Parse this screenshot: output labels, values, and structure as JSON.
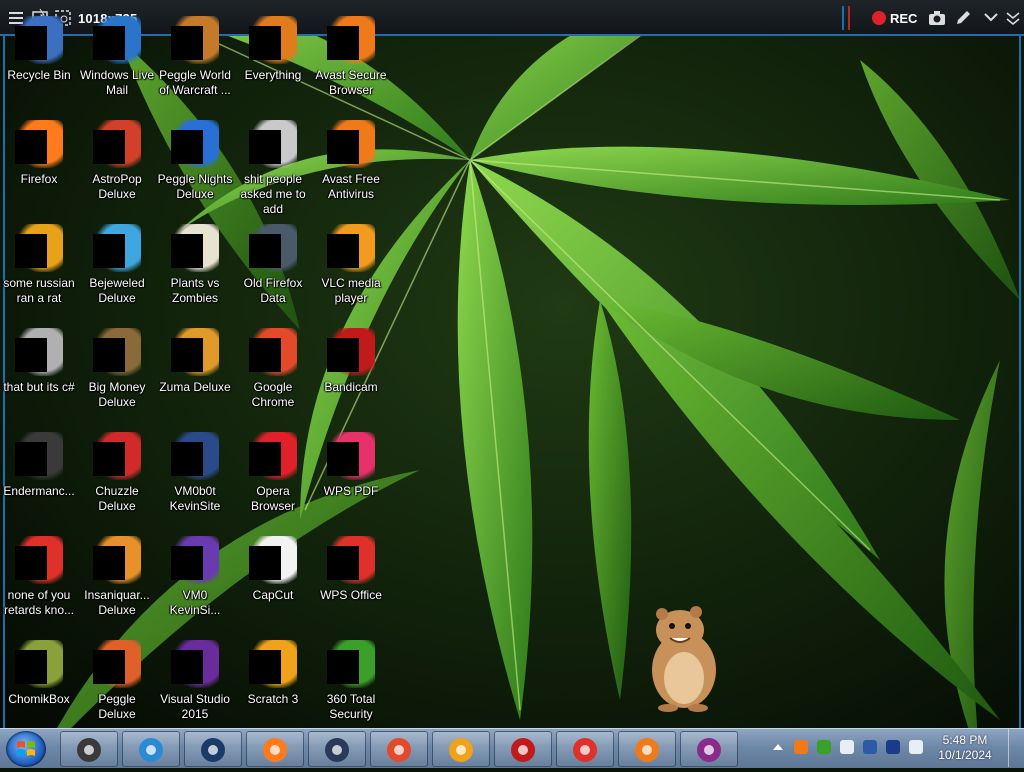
{
  "recorder": {
    "size_text": "1018x735",
    "rec_text": "REC",
    "icons": [
      "menu-icon",
      "window-capture-icon",
      "region-capture-icon",
      "record-dot-icon",
      "camera-icon",
      "pencil-icon",
      "chevron-down-icon",
      "collapse-icon"
    ],
    "accent": "#1f6fb0",
    "rec_color": "#e0202a"
  },
  "desktop": {
    "icons": [
      {
        "label": "Recycle Bin",
        "color": "#3b6fc2"
      },
      {
        "label": "Windows Live\nMail",
        "color": "#2a74c9"
      },
      {
        "label": "Peggle World\nof Warcraft ...",
        "color": "#c47a2a"
      },
      {
        "label": "Everything",
        "color": "#e07b1e"
      },
      {
        "label": "Avast Secure\nBrowser",
        "color": "#f07a1a"
      },
      {
        "label": "Firefox",
        "color": "#ff7a1a"
      },
      {
        "label": "AstroPop\nDeluxe",
        "color": "#d2402a"
      },
      {
        "label": "Peggle Nights\nDeluxe",
        "color": "#2a6fd6"
      },
      {
        "label": "shit people\nasked me to\nadd",
        "color": "#c9c9c9"
      },
      {
        "label": "Avast Free\nAntivirus",
        "color": "#f07a1a"
      },
      {
        "label": "some russian\nran a rat",
        "color": "#e8a21a"
      },
      {
        "label": "Bejeweled\nDeluxe",
        "color": "#3fa6e0"
      },
      {
        "label": "Plants vs\nZombies",
        "color": "#e8e2d0"
      },
      {
        "label": "Old Firefox\nData",
        "color": "#4a5a6a"
      },
      {
        "label": "VLC media\nplayer",
        "color": "#f29b1e"
      },
      {
        "label": "that but its c#",
        "color": "#b0b0b0"
      },
      {
        "label": "Big Money\nDeluxe",
        "color": "#8a6a3a"
      },
      {
        "label": "Zuma Deluxe",
        "color": "#e09a2a"
      },
      {
        "label": "Google\nChrome",
        "color": "#e24a2a"
      },
      {
        "label": "Bandicam",
        "color": "#c01a1a"
      },
      {
        "label": "Endermanc...",
        "color": "#3a3a3a"
      },
      {
        "label": "Chuzzle\nDeluxe",
        "color": "#d22a2a"
      },
      {
        "label": "VM0b0t\nKevinSite",
        "color": "#2a4a8a"
      },
      {
        "label": "Opera\nBrowser",
        "color": "#e0202a"
      },
      {
        "label": "WPS PDF",
        "color": "#e8306a"
      },
      {
        "label": "none of you\nretards kno...",
        "color": "#e0302a"
      },
      {
        "label": "Insaniquar...\nDeluxe",
        "color": "#e8902a"
      },
      {
        "label": "VM0\nKevinSi...",
        "color": "#6a3ab0"
      },
      {
        "label": "CapCut",
        "color": "#f2f2f2"
      },
      {
        "label": "WPS Office",
        "color": "#e0302a"
      },
      {
        "label": "ChomikBox",
        "color": "#8aa03a"
      },
      {
        "label": "Peggle Deluxe",
        "color": "#e0602a"
      },
      {
        "label": "Visual Studio\n2015",
        "color": "#6a2c9c"
      },
      {
        "label": "Scratch 3",
        "color": "#f0a21a"
      },
      {
        "label": "360 Total\nSecurity",
        "color": "#3aa02a"
      }
    ]
  },
  "taskbar": {
    "start_icon": "windows-start-icon",
    "pinned": [
      {
        "name": "folder-icon",
        "color": "#3a3a3a"
      },
      {
        "name": "media-player-icon",
        "color": "#2a8ad6"
      },
      {
        "name": "globe-icon",
        "color": "#1a3a6a"
      },
      {
        "name": "firefox-icon",
        "color": "#ff7a1a"
      },
      {
        "name": "vm-box-icon",
        "color": "#2a3a5a"
      },
      {
        "name": "chrome-icon",
        "color": "#e24a2a"
      },
      {
        "name": "avast-browser-icon",
        "color": "#f0a21a"
      },
      {
        "name": "bandicam-icon",
        "color": "#c01a1a"
      },
      {
        "name": "wps-office-icon",
        "color": "#e0302a"
      },
      {
        "name": "avast-antivirus-icon",
        "color": "#f07a1a"
      },
      {
        "name": "winrar-icon",
        "color": "#8a2a8a"
      }
    ],
    "tray_icons": [
      "show-hidden-icons-chevron",
      "avast-tray-icon",
      "360-tray-icon",
      "network-drive-icon",
      "shield-icon",
      "display-icon",
      "volume-icon"
    ],
    "time": "5:48 PM",
    "date": "10/1/2024"
  }
}
